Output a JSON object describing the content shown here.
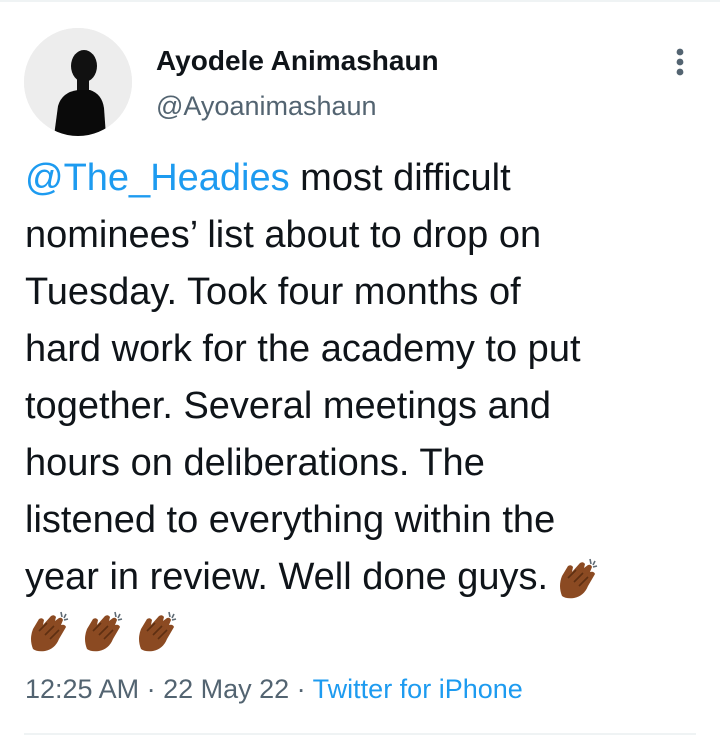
{
  "author": {
    "display_name": "Ayodele Animashaun",
    "handle": "@Ayoanimashaun",
    "avatar_icon": "profile-silhouette-icon"
  },
  "more_icon": "more-options-icon",
  "tweet": {
    "mention": "@The_Headies",
    "lines": [
      " most difficult",
      "nominees’ list about to drop on",
      "Tuesday. Took four months of",
      "hard work for the academy to put",
      "together. Several meetings and",
      "hours on deliberations. The",
      "listened to everything within the",
      "year in review. Well done guys."
    ],
    "emoji_icon": "clapping-hands-icon",
    "emoji_count": 4
  },
  "meta": {
    "time": "12:25 AM",
    "separator1": " · ",
    "date": "22 May 22",
    "separator2": " · ",
    "source": "Twitter for iPhone"
  },
  "colors": {
    "link": "#1d9bf0",
    "secondary_text": "#536471",
    "text": "#0f1419",
    "clap_skin": "#8b4a22"
  }
}
